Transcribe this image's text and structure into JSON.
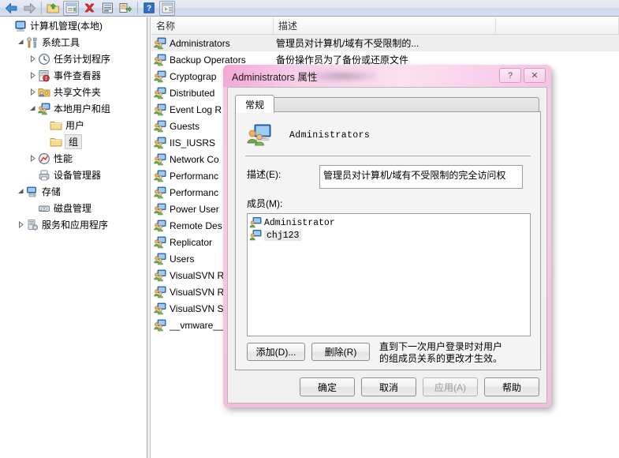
{
  "toolbar": {
    "items": [
      {
        "name": "back-icon",
        "label": "后退"
      },
      {
        "name": "forward-icon",
        "label": "前进"
      },
      {
        "name": "up-folder-icon",
        "label": "上移一级"
      },
      {
        "name": "properties-icon",
        "label": "属性"
      },
      {
        "name": "delete-icon",
        "label": "删除"
      },
      {
        "name": "refresh-icon",
        "label": "刷新"
      },
      {
        "name": "export-list-icon",
        "label": "导出列表"
      },
      {
        "name": "help-icon",
        "label": "帮助"
      },
      {
        "name": "show-hide-console-icon",
        "label": "显示/隐藏操作窗格"
      }
    ]
  },
  "tree": {
    "items": [
      {
        "label": "计算机管理(本地)",
        "indent": 0,
        "twisty": "none",
        "icon": "computer-icon",
        "selected": false
      },
      {
        "label": "系统工具",
        "indent": 1,
        "twisty": "expanded",
        "icon": "tools-icon",
        "selected": false
      },
      {
        "label": "任务计划程序",
        "indent": 2,
        "twisty": "collapsed",
        "icon": "clock-icon",
        "selected": false
      },
      {
        "label": "事件查看器",
        "indent": 2,
        "twisty": "collapsed",
        "icon": "event-viewer-icon",
        "selected": false
      },
      {
        "label": "共享文件夹",
        "indent": 2,
        "twisty": "collapsed",
        "icon": "shared-folder-icon",
        "selected": false
      },
      {
        "label": "本地用户和组",
        "indent": 2,
        "twisty": "expanded",
        "icon": "users-groups-icon",
        "selected": false
      },
      {
        "label": "用户",
        "indent": 3,
        "twisty": "none",
        "icon": "folder-icon",
        "selected": false
      },
      {
        "label": "组",
        "indent": 3,
        "twisty": "none",
        "icon": "folder-icon",
        "selected": true
      },
      {
        "label": "性能",
        "indent": 2,
        "twisty": "collapsed",
        "icon": "performance-icon",
        "selected": false
      },
      {
        "label": "设备管理器",
        "indent": 2,
        "twisty": "none",
        "icon": "device-manager-icon",
        "selected": false
      },
      {
        "label": "存储",
        "indent": 1,
        "twisty": "expanded",
        "icon": "storage-icon",
        "selected": false
      },
      {
        "label": "磁盘管理",
        "indent": 2,
        "twisty": "none",
        "icon": "disk-icon",
        "selected": false
      },
      {
        "label": "服务和应用程序",
        "indent": 1,
        "twisty": "collapsed",
        "icon": "services-icon",
        "selected": false
      }
    ]
  },
  "list": {
    "columns": [
      "名称",
      "描述"
    ],
    "rows": [
      {
        "name": "Administrators",
        "desc": "管理员对计算机/域有不受限制的...",
        "selected": true
      },
      {
        "name": "Backup Operators",
        "desc": "备份操作员为了备份或还原文件",
        "selected": false
      },
      {
        "name": "Cryptograp",
        "desc": "",
        "selected": false
      },
      {
        "name": "Distributed",
        "desc": "",
        "selected": false
      },
      {
        "name": "Event Log R",
        "desc": "",
        "selected": false
      },
      {
        "name": "Guests",
        "desc": "",
        "selected": false
      },
      {
        "name": "IIS_IUSRS",
        "desc": "",
        "selected": false
      },
      {
        "name": "Network Co",
        "desc": "",
        "selected": false
      },
      {
        "name": "Performanc",
        "desc": "",
        "selected": false
      },
      {
        "name": "Performanc",
        "desc": "",
        "selected": false
      },
      {
        "name": "Power User",
        "desc": "",
        "selected": false
      },
      {
        "name": "Remote Des",
        "desc": "",
        "selected": false
      },
      {
        "name": "Replicator",
        "desc": "",
        "selected": false
      },
      {
        "name": "Users",
        "desc": "",
        "selected": false
      },
      {
        "name": "VisualSVN R",
        "desc": "",
        "selected": false
      },
      {
        "name": "VisualSVN R",
        "desc": "",
        "selected": false
      },
      {
        "name": "VisualSVN S",
        "desc": "",
        "selected": false
      },
      {
        "name": "__vmware__",
        "desc": "",
        "selected": false
      }
    ]
  },
  "dialog": {
    "title": "Administrators 属性",
    "help_button": "?",
    "close_button": "✕",
    "tab_label": "常规",
    "group_name": "Administrators",
    "description_label": "描述(E):",
    "description_value": "管理员对计算机/域有不受限制的完全访问权",
    "members_label": "成员(M):",
    "members": [
      {
        "name": "Administrator",
        "selected": false
      },
      {
        "name": "chj123",
        "selected": true
      }
    ],
    "add_button": "添加(D)...",
    "remove_button": "删除(R)",
    "hint": "直到下一次用户登录时对用户的组成员关系的更改才生效。",
    "ok_button": "确定",
    "cancel_button": "取消",
    "apply_button": "应用(A)",
    "help_footer_button": "帮助",
    "apply_disabled": true
  },
  "colors": {
    "dialog_accent": "#f3a8d4",
    "toolbar_bg": "#dfe5f2",
    "selection": "#eeeeee"
  }
}
